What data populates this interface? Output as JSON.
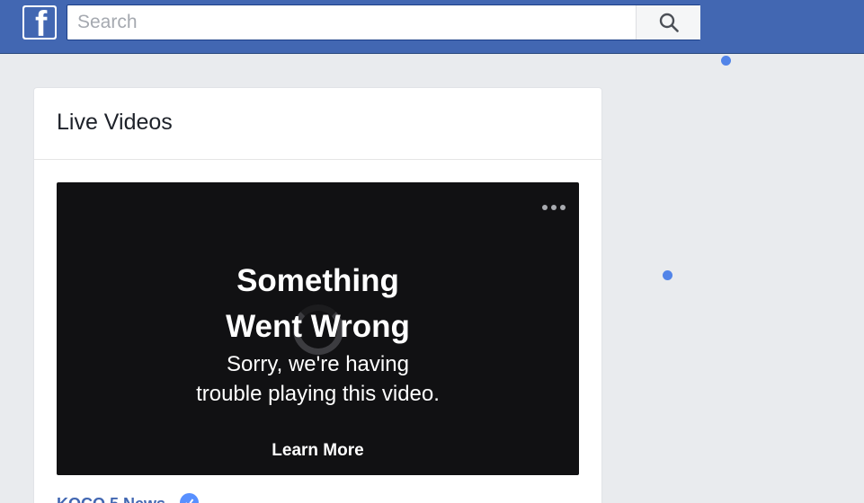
{
  "header": {
    "logo_icon": "facebook-f-logo",
    "search": {
      "placeholder": "Search",
      "value": ""
    },
    "search_button_icon": "magnifier-icon",
    "colors": {
      "bar": "#4267b2",
      "bar_border": "#29487d"
    }
  },
  "card": {
    "title": "Live Videos",
    "video": {
      "error_title": "Something\nWent Wrong",
      "error_message": "Sorry, we're having\ntrouble playing this video.",
      "learn_more_label": "Learn More",
      "more_icon": "ellipsis-icon",
      "loading_icon": "spinner-icon"
    },
    "source": {
      "name": "KOCO 5 News",
      "badge_icon": "verified-check-icon"
    }
  },
  "markers": {
    "color": "#5284e8",
    "icon": "blue-dot-marker"
  }
}
